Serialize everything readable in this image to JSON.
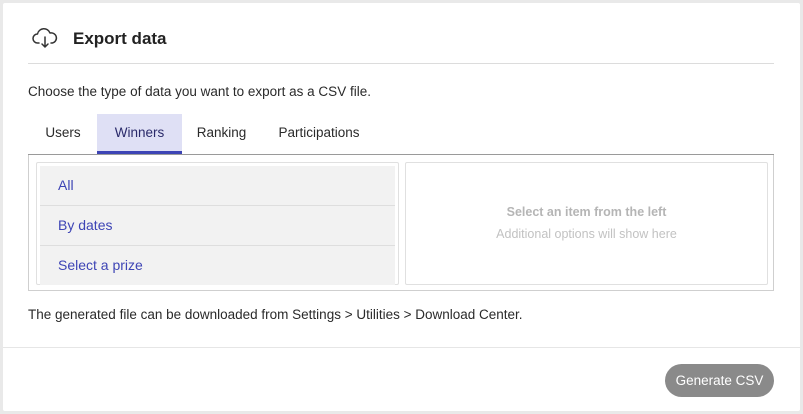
{
  "header": {
    "icon": "cloud-download-icon",
    "title": "Export data"
  },
  "intro": "Choose the type of data you want to export as a CSV file.",
  "tabs": [
    {
      "label": "Users",
      "active": false
    },
    {
      "label": "Winners",
      "active": true
    },
    {
      "label": "Ranking",
      "active": false
    },
    {
      "label": "Participations",
      "active": false
    }
  ],
  "options": [
    {
      "label": "All"
    },
    {
      "label": "By dates"
    },
    {
      "label": "Select a prize"
    }
  ],
  "detail_panel": {
    "title": "Select an item from the left",
    "subtitle": "Additional options will show here"
  },
  "note": "The generated file can be downloaded from Settings > Utilities > Download Center.",
  "footer": {
    "generate_label": "Generate CSV"
  },
  "colors": {
    "accent": "#3d44b5",
    "active_tab_bg": "#dfe0f5",
    "button_bg": "#8a8a8a"
  }
}
